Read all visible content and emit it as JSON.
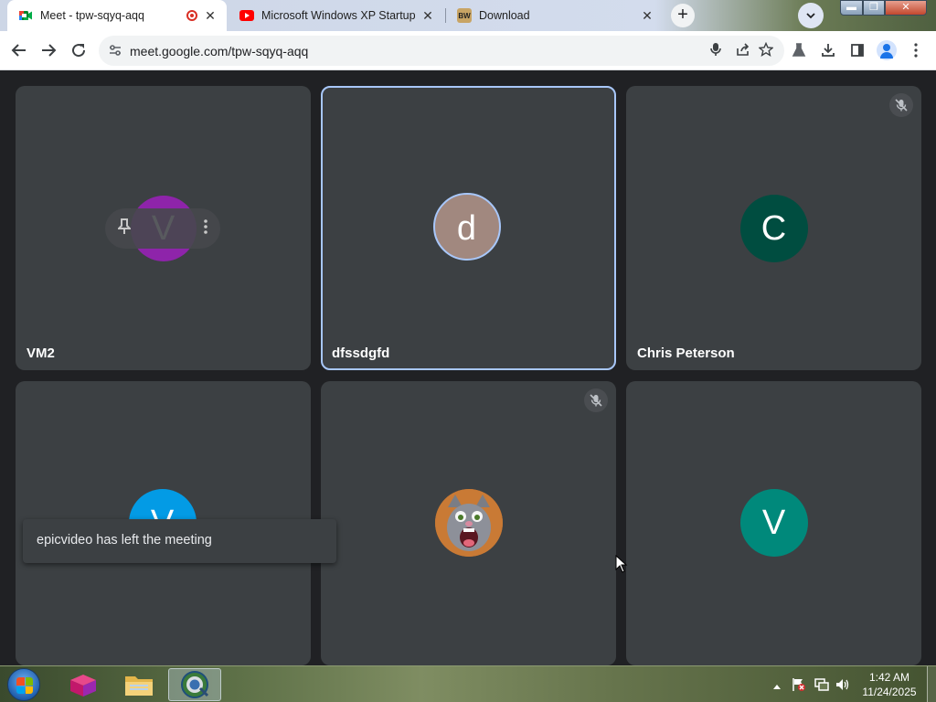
{
  "browser": {
    "tabs": [
      {
        "title": "Meet - tpw-sqyq-aqq",
        "icon": "google-meet-icon",
        "recording": true
      },
      {
        "title": "Microsoft Windows XP Startup S",
        "icon": "youtube-icon"
      },
      {
        "title": "Download",
        "icon": "bw-icon",
        "icon_text": "BW"
      }
    ],
    "url": "meet.google.com/tpw-sqyq-aqq"
  },
  "meeting": {
    "participants": [
      {
        "name": "VM2",
        "initial": "V",
        "avatar_color": "#8e24aa",
        "muted": false,
        "pinned_controls": true
      },
      {
        "name": "dfssdgfd",
        "initial": "d",
        "avatar_color": "#a1887f",
        "muted": false,
        "speaking": true
      },
      {
        "name": "Chris Peterson",
        "initial": "C",
        "avatar_color": "#004d40",
        "muted": true
      },
      {
        "name": "",
        "initial": "V",
        "avatar_color": "#039be5",
        "muted": false
      },
      {
        "name": "",
        "initial": "",
        "avatar_image": "talking-cat-avatar",
        "muted": true
      },
      {
        "name": "",
        "initial": "V",
        "avatar_color": "#00897b",
        "muted": false
      }
    ],
    "toast": "epicvideo has left the meeting"
  },
  "taskbar": {
    "clock_time": "1:42 AM",
    "clock_date": "11/24/2025"
  }
}
